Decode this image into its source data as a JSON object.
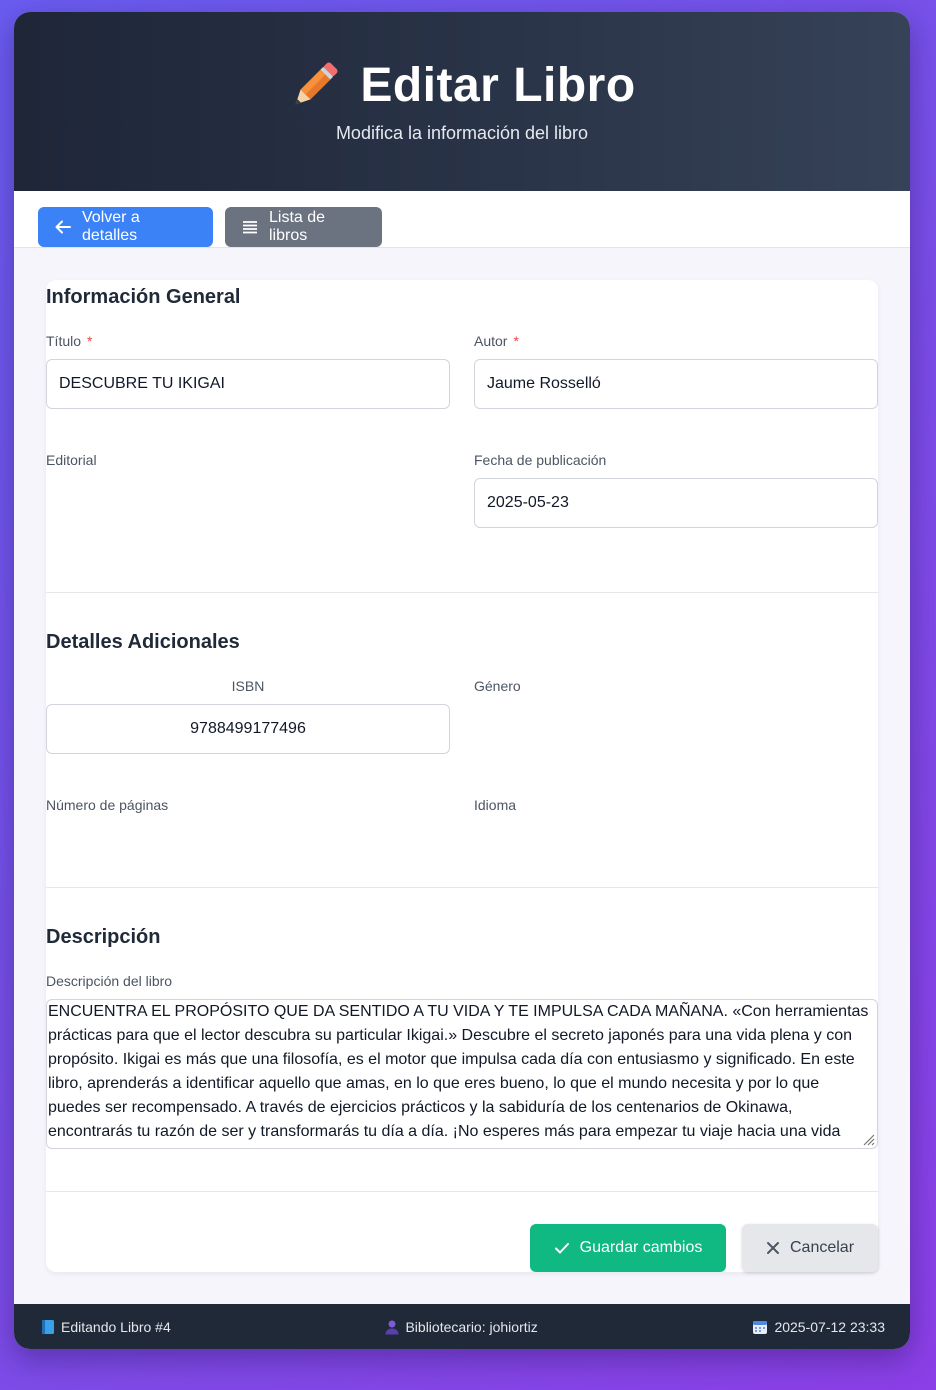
{
  "header": {
    "icon": "pencil-icon",
    "title": "Editar Libro",
    "subtitle": "Modifica la información del libro"
  },
  "nav": {
    "back_label": "Volver a detalles",
    "list_label": "Lista de libros"
  },
  "general": {
    "section_title": "Información General",
    "titulo_label": "Título",
    "titulo_value": "DESCUBRE TU IKIGAI",
    "autor_label": "Autor",
    "autor_value": "Jaume Rosselló",
    "required_mark": "*",
    "editorial_label": "Editorial",
    "fecha_label": "Fecha de publicación",
    "fecha_value": "2025-05-23"
  },
  "details": {
    "section_title": "Detalles Adicionales",
    "isbn_label": "ISBN",
    "isbn_value": "9788499177496",
    "genero_label": "Género",
    "paginas_label": "Número de páginas",
    "idioma_label": "Idioma"
  },
  "description": {
    "section_title": "Descripción",
    "label": "Descripción del libro",
    "value": "ENCUENTRA EL PROPÓSITO QUE DA SENTIDO A TU VIDA Y TE IMPULSA CADA MAÑANA. «Con herramientas prácticas para que el lector descubra su particular Ikigai.» Descubre el secreto japonés para una vida plena y con propósito. Ikigai es más que una filosofía, es el motor que impulsa cada día con entusiasmo y significado. En este libro, aprenderás a identificar aquello que amas, en lo que eres bueno, lo que el mundo necesita y por lo que puedes ser recompensado. A través de ejercicios prácticos y la sabiduría de los centenarios de Okinawa, encontrarás tu razón de ser y transformarás tu día a día. ¡No esperes más para empezar tu viaje hacia una vida más feliz y auténtica! • Tu"
  },
  "actions": {
    "save_label": "Guardar cambios",
    "cancel_label": "Cancelar"
  },
  "footer": {
    "editing": "Editando Libro #4",
    "librarian": "Bibliotecario: johiortiz",
    "datetime": "2025-07-12 23:33"
  },
  "colors": {
    "primary": "#3b82f6",
    "secondary": "#6b7280",
    "success": "#10b981",
    "header_bg": "#1e2638",
    "footer_bg": "#1f2937"
  }
}
